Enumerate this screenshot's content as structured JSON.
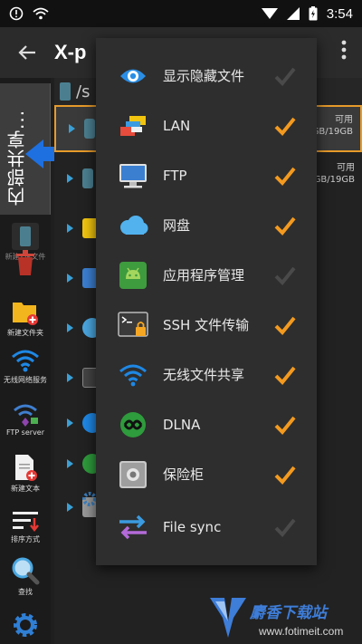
{
  "status_bar": {
    "time": "3:54"
  },
  "app_bar": {
    "title": "X-p"
  },
  "path_bar": {
    "path": "/s"
  },
  "share_tab": {
    "label": "内部共享..."
  },
  "toolbar": {
    "items": [
      {
        "label": "新建ZIP文件",
        "icon": "zip-icon",
        "color": "#4b7f90"
      },
      {
        "label": "",
        "icon": "trash-icon",
        "color": "#c0392b"
      },
      {
        "label": "新建文件夹",
        "icon": "new-folder-icon",
        "color": "#f3b51d"
      },
      {
        "label": "无线网络服务",
        "icon": "wifi-icon",
        "color": "#1e88e5"
      },
      {
        "label": "FTP server",
        "icon": "ftp-server-icon",
        "color": "#3f7fd0"
      },
      {
        "label": "新建文本",
        "icon": "new-text-icon",
        "color": "#e0e0e0"
      },
      {
        "label": "排序方式",
        "icon": "sort-icon",
        "color": "#e53935"
      },
      {
        "label": "查找",
        "icon": "search-icon",
        "color": "#4aa7e0"
      },
      {
        "label": "",
        "icon": "settings-icon",
        "color": "#2f7fd5"
      }
    ]
  },
  "file_rows": [
    {
      "info_line1": "可用",
      "info_line2": "GB/19GB",
      "icon": "phone-icon",
      "selected": true
    },
    {
      "info_line1": "可用",
      "info_line2": "GB/19GB",
      "icon": "phone-icon",
      "selected": false
    },
    {
      "info_line1": "",
      "info_line2": "",
      "icon": "lan-icon",
      "selected": false
    },
    {
      "info_line1": "",
      "info_line2": "",
      "icon": "ftp-icon",
      "selected": false
    },
    {
      "info_line1": "",
      "info_line2": "",
      "icon": "cloud-icon",
      "selected": false
    },
    {
      "info_line1": "",
      "info_line2": "",
      "icon": "terminal-icon",
      "selected": false
    },
    {
      "info_line1": "",
      "info_line2": "",
      "icon": "wifi-icon",
      "selected": false
    },
    {
      "info_line1": "",
      "info_line2": "",
      "icon": "dlna-icon",
      "selected": false
    },
    {
      "info_line1": "",
      "info_line2": "",
      "icon": "safe-icon",
      "selected": false
    }
  ],
  "menu": {
    "items": [
      {
        "label": "显示隐藏文件",
        "icon": "eye-icon",
        "checked": false
      },
      {
        "label": "LAN",
        "icon": "lan-icon",
        "checked": true
      },
      {
        "label": "FTP",
        "icon": "ftp-icon",
        "checked": true
      },
      {
        "label": "网盘",
        "icon": "cloud-icon",
        "checked": true
      },
      {
        "label": "应用程序管理",
        "icon": "android-icon",
        "checked": false
      },
      {
        "label": "SSH 文件传输",
        "icon": "ssh-icon",
        "checked": true
      },
      {
        "label": "无线文件共享",
        "icon": "wifi-icon",
        "checked": true
      },
      {
        "label": "DLNA",
        "icon": "dlna-icon",
        "checked": true
      },
      {
        "label": "保险柜",
        "icon": "safe-icon",
        "checked": true
      },
      {
        "label": "File sync",
        "icon": "sync-icon",
        "checked": false
      }
    ],
    "check_on_color": "#f39a1f",
    "check_off_color": "#4a4a4a"
  },
  "watermark": {
    "title": "麝香下载站",
    "url": "www.fotimeit.com"
  }
}
